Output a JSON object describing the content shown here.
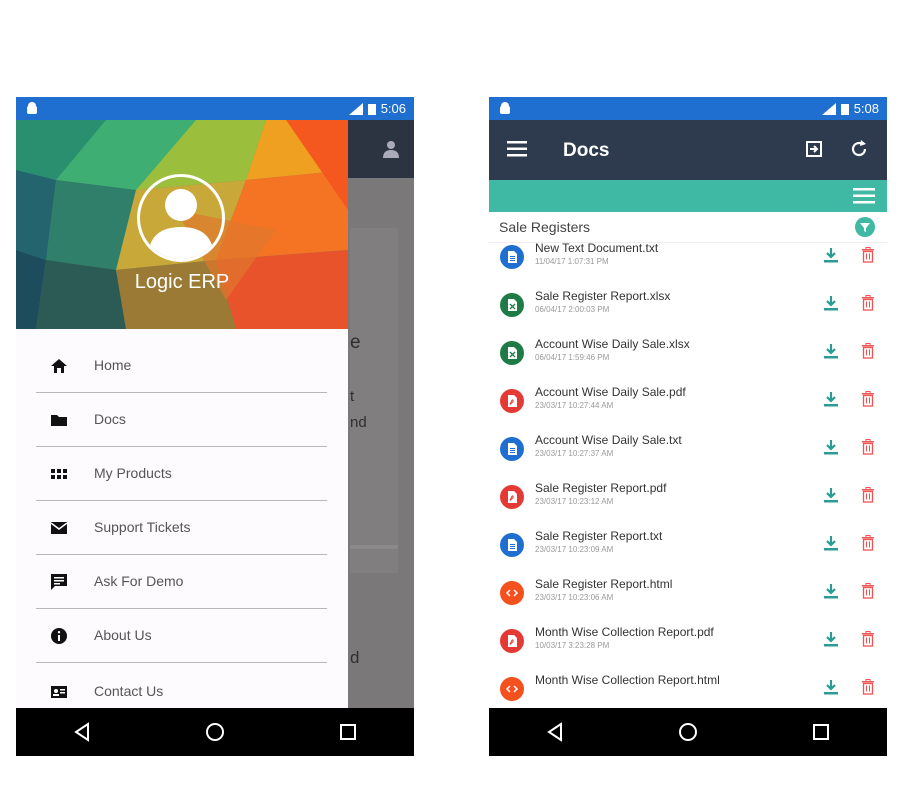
{
  "left_phone": {
    "status_time": "5:06",
    "drawer": {
      "brand": "Logic ERP",
      "items": [
        {
          "label": "Home",
          "icon": "home-icon"
        },
        {
          "label": "Docs",
          "icon": "folder-icon"
        },
        {
          "label": "My Products",
          "icon": "grid-icon"
        },
        {
          "label": "Support Tickets",
          "icon": "mail-icon"
        },
        {
          "label": "Ask For Demo",
          "icon": "chat-icon"
        },
        {
          "label": "About Us",
          "icon": "info-icon"
        },
        {
          "label": "Contact Us",
          "icon": "contact-card-icon"
        }
      ]
    },
    "background_fragments": [
      "e",
      "t",
      "nd",
      "d"
    ]
  },
  "right_phone": {
    "status_time": "5:08",
    "appbar": {
      "title": "Docs"
    },
    "section": {
      "label": "Sale Registers"
    },
    "files": [
      {
        "name": "New Text Document.txt",
        "date": "11/04/17 1:07:31 PM",
        "type": "txt"
      },
      {
        "name": "Sale Register Report.xlsx",
        "date": "06/04/17 2:00:03 PM",
        "type": "xlsx"
      },
      {
        "name": "Account Wise Daily Sale.xlsx",
        "date": "06/04/17 1:59:46 PM",
        "type": "xlsx"
      },
      {
        "name": "Account Wise Daily Sale.pdf",
        "date": "23/03/17 10:27:44 AM",
        "type": "pdf"
      },
      {
        "name": "Account Wise Daily Sale.txt",
        "date": "23/03/17 10:27:37 AM",
        "type": "txt"
      },
      {
        "name": "Sale Register Report.pdf",
        "date": "23/03/17 10:23:12 AM",
        "type": "pdf"
      },
      {
        "name": "Sale Register Report.txt",
        "date": "23/03/17 10:23:09 AM",
        "type": "txt"
      },
      {
        "name": "Sale Register Report.html",
        "date": "23/03/17 10:23:06 AM",
        "type": "html"
      },
      {
        "name": "Month Wise Collection Report.pdf",
        "date": "10/03/17 3:23:28 PM",
        "type": "pdf"
      },
      {
        "name": "Month Wise Collection Report.html",
        "date": "",
        "type": "html"
      }
    ]
  },
  "colors": {
    "status_bar": "#1e6fd0",
    "app_bar": "#2e3a4d",
    "accent_teal": "#3fb9a3",
    "download_green": "#2a9d8f",
    "delete_red": "#ef5350",
    "txt_blue": "#1e6fd0",
    "xlsx_green": "#1e7a46",
    "pdf_red": "#e53935",
    "html_orange": "#f4511e"
  }
}
